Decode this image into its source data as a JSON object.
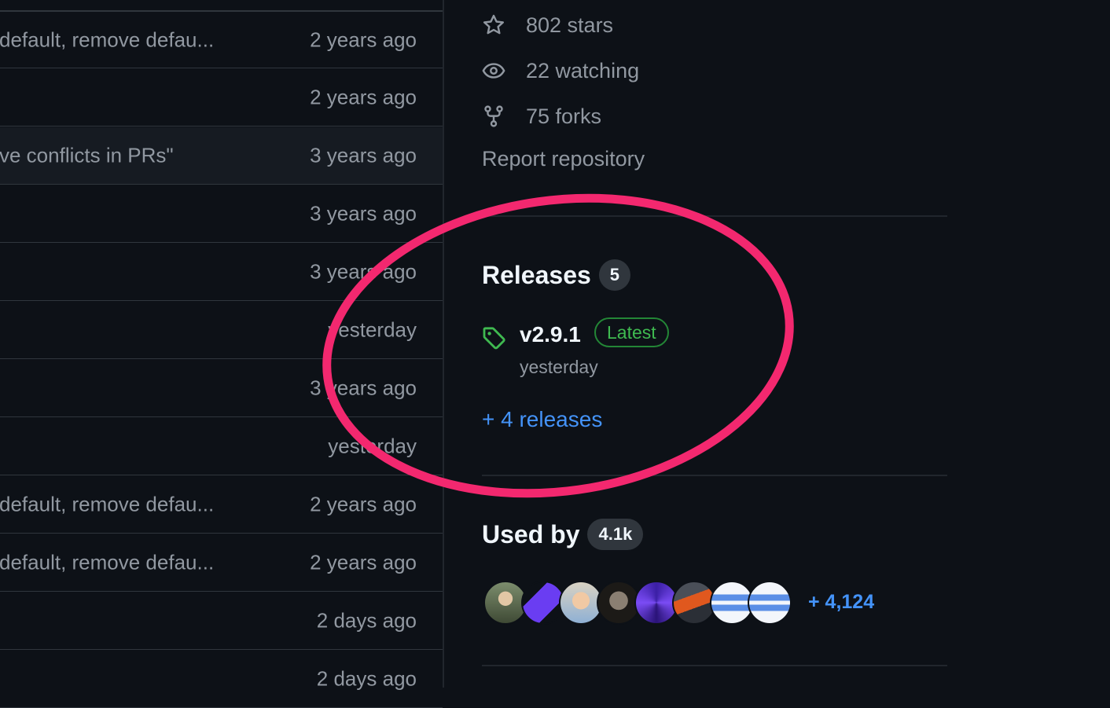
{
  "file_list": {
    "rows": [
      {
        "message": "default, remove defau...",
        "age": "2 years ago",
        "highlight": false
      },
      {
        "message": "",
        "age": "2 years ago",
        "highlight": false
      },
      {
        "message": "ve conflicts in PRs\"",
        "age": "3 years ago",
        "highlight": true
      },
      {
        "message": "",
        "age": "3 years ago",
        "highlight": false
      },
      {
        "message": "",
        "age": "3 years ago",
        "highlight": false
      },
      {
        "message": "",
        "age": "yesterday",
        "highlight": false
      },
      {
        "message": "",
        "age": "3 years ago",
        "highlight": false
      },
      {
        "message": "",
        "age": "yesterday",
        "highlight": false
      },
      {
        "message": "default, remove defau...",
        "age": "2 years ago",
        "highlight": false
      },
      {
        "message": "default, remove defau...",
        "age": "2 years ago",
        "highlight": false
      },
      {
        "message": "",
        "age": "2 days ago",
        "highlight": false
      },
      {
        "message": "",
        "age": "2 days ago",
        "highlight": false
      }
    ]
  },
  "sidebar": {
    "stars": {
      "text": "802 stars",
      "icon": "star-icon"
    },
    "watching": {
      "text": "22 watching",
      "icon": "eye-icon"
    },
    "forks": {
      "text": "75 forks",
      "icon": "fork-icon"
    },
    "report": "Report repository",
    "releases": {
      "title": "Releases",
      "count": "5",
      "latest": {
        "name": "v2.9.1",
        "badge": "Latest",
        "date": "yesterday",
        "icon": "tag-icon"
      },
      "more": "+ 4 releases"
    },
    "used_by": {
      "title": "Used by",
      "count": "4.1k",
      "more": "+ 4,124",
      "avatars": [
        "avatar-person-outdoor",
        "avatar-purple-logo",
        "avatar-person-blond",
        "avatar-statue",
        "avatar-purple-swirl",
        "avatar-person-orange",
        "avatar-identicon-blue",
        "avatar-identicon-blue"
      ]
    }
  },
  "colors": {
    "background": "#0d1117",
    "text_muted": "#9198a1",
    "link_blue": "#4493f8",
    "latest_green": "#3fb950",
    "annotation_pink": "#f3286f"
  }
}
